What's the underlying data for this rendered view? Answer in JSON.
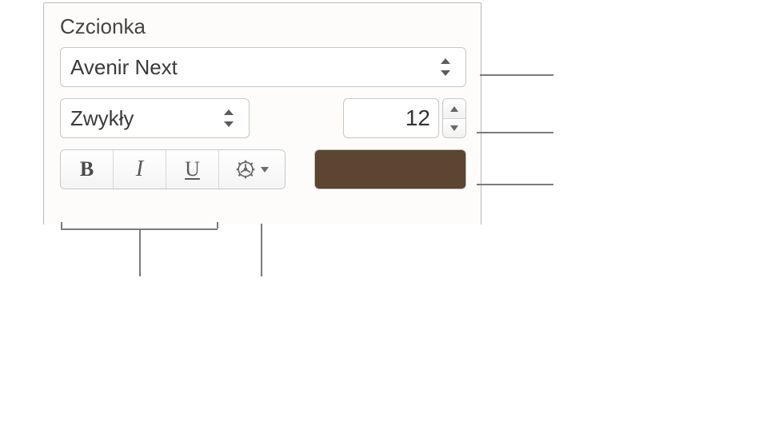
{
  "font_section": {
    "title": "Czcionka",
    "family": "Avenir Next",
    "weight": "Zwykły",
    "size": "12",
    "color_hex": "#5d4631"
  },
  "icons": {
    "bold": "B",
    "italic": "I",
    "underline": "U"
  }
}
